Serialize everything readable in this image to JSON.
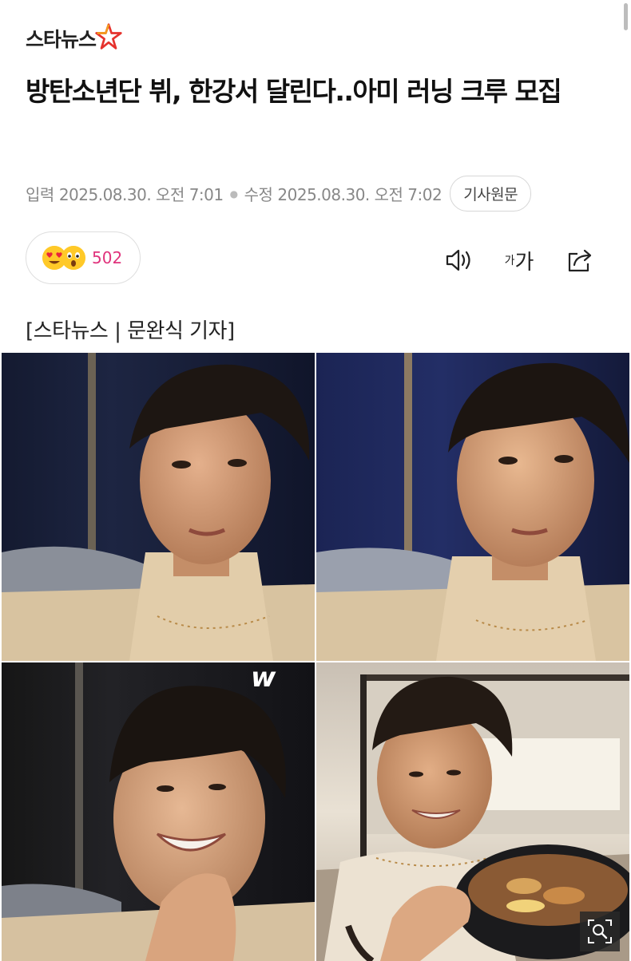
{
  "header": {
    "logo_text": "스타뉴스",
    "logo_star_icon": "star-logo-icon"
  },
  "article": {
    "title": "방탄소년단 뷔, 한강서 달린다..아미 러닝 크루 모집",
    "input_label": "입력",
    "input_date": "2025.08.30. 오전 7:01",
    "edit_label": "수정",
    "edit_date": "2025.08.30. 오전 7:02",
    "original_button": "기사원문",
    "byline": "[스타뉴스 | 문완식 기자]"
  },
  "reactions": {
    "icons": [
      "heart-eyes-emoji-icon",
      "surprised-emoji-icon"
    ],
    "count": "502"
  },
  "toolbar": {
    "audio_icon": "speaker-icon",
    "font_small": "가",
    "font_large": "가",
    "share_icon": "share-icon"
  },
  "photo": {
    "zoom_icon": "zoom-icon",
    "sticker_text": "w"
  },
  "colors": {
    "reaction_count": "#e0337c",
    "logo_star_red": "#e5322d",
    "logo_star_orange": "#f39a1e"
  }
}
